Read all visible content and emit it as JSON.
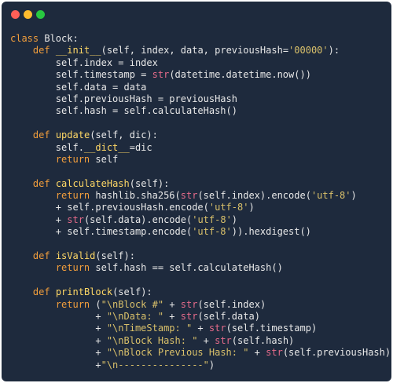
{
  "window": {
    "buttons": [
      {
        "name": "close",
        "color": "#ff5f57"
      },
      {
        "name": "minimize",
        "color": "#febc2e"
      },
      {
        "name": "zoom",
        "color": "#28c840"
      }
    ]
  },
  "theme": {
    "background": "#1e2a3d",
    "keyword": "#f29e3c",
    "function": "#ffd866",
    "string": "#d9c06a",
    "builtin": "#e56b8a",
    "text": "#e8e8e8"
  },
  "code_lines": [
    [
      {
        "t": "kw",
        "v": "class"
      },
      {
        "t": "plain",
        "v": " Block:"
      }
    ],
    [
      {
        "t": "plain",
        "v": "    "
      },
      {
        "t": "kw",
        "v": "def"
      },
      {
        "t": "plain",
        "v": " "
      },
      {
        "t": "fn",
        "v": "__init__"
      },
      {
        "t": "plain",
        "v": "(self, index, data, previousHash="
      },
      {
        "t": "str",
        "v": "'00000'"
      },
      {
        "t": "plain",
        "v": "):"
      }
    ],
    [
      {
        "t": "plain",
        "v": "        self.index = index"
      }
    ],
    [
      {
        "t": "plain",
        "v": "        self.timestamp = "
      },
      {
        "t": "builtin",
        "v": "str"
      },
      {
        "t": "plain",
        "v": "(datetime.datetime.now())"
      }
    ],
    [
      {
        "t": "plain",
        "v": "        self.data = data"
      }
    ],
    [
      {
        "t": "plain",
        "v": "        self.previousHash = previousHash"
      }
    ],
    [
      {
        "t": "plain",
        "v": "        self.hash = self.calculateHash()"
      }
    ],
    [
      {
        "t": "plain",
        "v": ""
      }
    ],
    [
      {
        "t": "plain",
        "v": "    "
      },
      {
        "t": "kw",
        "v": "def"
      },
      {
        "t": "plain",
        "v": " "
      },
      {
        "t": "fn",
        "v": "update"
      },
      {
        "t": "plain",
        "v": "(self, dic):"
      }
    ],
    [
      {
        "t": "plain",
        "v": "        self."
      },
      {
        "t": "fn",
        "v": "__dict__"
      },
      {
        "t": "plain",
        "v": "=dic"
      }
    ],
    [
      {
        "t": "plain",
        "v": "        "
      },
      {
        "t": "kw",
        "v": "return"
      },
      {
        "t": "plain",
        "v": " self"
      }
    ],
    [
      {
        "t": "plain",
        "v": ""
      }
    ],
    [
      {
        "t": "plain",
        "v": "    "
      },
      {
        "t": "kw",
        "v": "def"
      },
      {
        "t": "plain",
        "v": " "
      },
      {
        "t": "fn",
        "v": "calculateHash"
      },
      {
        "t": "plain",
        "v": "(self):"
      }
    ],
    [
      {
        "t": "plain",
        "v": "        "
      },
      {
        "t": "kw",
        "v": "return"
      },
      {
        "t": "plain",
        "v": " hashlib.sha256("
      },
      {
        "t": "builtin",
        "v": "str"
      },
      {
        "t": "plain",
        "v": "(self.index).encode("
      },
      {
        "t": "str",
        "v": "'utf-8'"
      },
      {
        "t": "plain",
        "v": ")"
      }
    ],
    [
      {
        "t": "plain",
        "v": "        + self.previousHash.encode("
      },
      {
        "t": "str",
        "v": "'utf-8'"
      },
      {
        "t": "plain",
        "v": ")"
      }
    ],
    [
      {
        "t": "plain",
        "v": "        + "
      },
      {
        "t": "builtin",
        "v": "str"
      },
      {
        "t": "plain",
        "v": "(self.data).encode("
      },
      {
        "t": "str",
        "v": "'utf-8'"
      },
      {
        "t": "plain",
        "v": ")"
      }
    ],
    [
      {
        "t": "plain",
        "v": "        + self.timestamp.encode("
      },
      {
        "t": "str",
        "v": "'utf-8'"
      },
      {
        "t": "plain",
        "v": ")).hexdigest()"
      }
    ],
    [
      {
        "t": "plain",
        "v": ""
      }
    ],
    [
      {
        "t": "plain",
        "v": "    "
      },
      {
        "t": "kw",
        "v": "def"
      },
      {
        "t": "plain",
        "v": " "
      },
      {
        "t": "fn",
        "v": "isValid"
      },
      {
        "t": "plain",
        "v": "(self):"
      }
    ],
    [
      {
        "t": "plain",
        "v": "        "
      },
      {
        "t": "kw",
        "v": "return"
      },
      {
        "t": "plain",
        "v": " self.hash == self.calculateHash()"
      }
    ],
    [
      {
        "t": "plain",
        "v": ""
      }
    ],
    [
      {
        "t": "plain",
        "v": "    "
      },
      {
        "t": "kw",
        "v": "def"
      },
      {
        "t": "plain",
        "v": " "
      },
      {
        "t": "fn",
        "v": "printBlock"
      },
      {
        "t": "plain",
        "v": "(self):"
      }
    ],
    [
      {
        "t": "plain",
        "v": "        "
      },
      {
        "t": "kw",
        "v": "return"
      },
      {
        "t": "plain",
        "v": " ("
      },
      {
        "t": "str",
        "v": "\"\\nBlock #\""
      },
      {
        "t": "plain",
        "v": " + "
      },
      {
        "t": "builtin",
        "v": "str"
      },
      {
        "t": "plain",
        "v": "(self.index)"
      }
    ],
    [
      {
        "t": "plain",
        "v": "               + "
      },
      {
        "t": "str",
        "v": "\"\\nData: \""
      },
      {
        "t": "plain",
        "v": " + "
      },
      {
        "t": "builtin",
        "v": "str"
      },
      {
        "t": "plain",
        "v": "(self.data)"
      }
    ],
    [
      {
        "t": "plain",
        "v": "               + "
      },
      {
        "t": "str",
        "v": "\"\\nTimeStamp: \""
      },
      {
        "t": "plain",
        "v": " + "
      },
      {
        "t": "builtin",
        "v": "str"
      },
      {
        "t": "plain",
        "v": "(self.timestamp)"
      }
    ],
    [
      {
        "t": "plain",
        "v": "               + "
      },
      {
        "t": "str",
        "v": "\"\\nBlock Hash: \""
      },
      {
        "t": "plain",
        "v": " + "
      },
      {
        "t": "builtin",
        "v": "str"
      },
      {
        "t": "plain",
        "v": "(self.hash)"
      }
    ],
    [
      {
        "t": "plain",
        "v": "               + "
      },
      {
        "t": "str",
        "v": "\"\\nBlock Previous Hash: \""
      },
      {
        "t": "plain",
        "v": " + "
      },
      {
        "t": "builtin",
        "v": "str"
      },
      {
        "t": "plain",
        "v": "(self.previousHash)"
      }
    ],
    [
      {
        "t": "plain",
        "v": "               +"
      },
      {
        "t": "str",
        "v": "\"\\n---------------\""
      },
      {
        "t": "plain",
        "v": ")"
      }
    ]
  ]
}
